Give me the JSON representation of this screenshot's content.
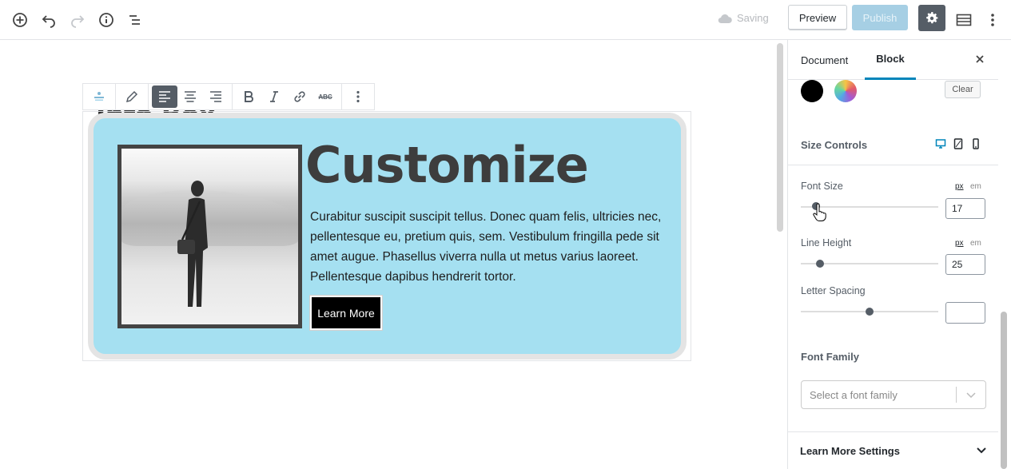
{
  "topbar": {
    "saving_label": "Saving",
    "preview_label": "Preview",
    "publish_label": "Publish"
  },
  "editor": {
    "post_title": "Info Box",
    "info_box": {
      "heading": "Customize",
      "body": "Curabitur suscipit suscipit tellus. Donec quam felis, ultricies nec, pellentesque eu, pretium quis, sem. Vestibulum fringilla pede sit amet augue. Phasellus viverra nulla ut metus varius laoreet. Pellentesque dapibus hendrerit tortor.",
      "button_label": "Learn More",
      "background_color": "#a5e0f1",
      "border_color": "#e4e4e4"
    },
    "toolbar": {
      "abc_label": "ABC"
    }
  },
  "sidebar": {
    "tabs": [
      {
        "label": "Document"
      },
      {
        "label": "Block"
      }
    ],
    "clear_label": "Clear",
    "size_controls_heading": "Size Controls",
    "font_size": {
      "label": "Font Size",
      "unit_px": "px",
      "unit_em": "em",
      "value": "17"
    },
    "line_height": {
      "label": "Line Height",
      "unit_px": "px",
      "unit_em": "em",
      "value": "25"
    },
    "letter_spacing": {
      "label": "Letter Spacing",
      "value": ""
    },
    "font_family": {
      "heading": "Font Family",
      "placeholder": "Select a font family"
    },
    "learn_more_settings": "Learn More Settings"
  },
  "colors": {
    "accent": "#0085ba",
    "publish_disabled": "#a6cfe4",
    "settings_active": "#555d66"
  }
}
